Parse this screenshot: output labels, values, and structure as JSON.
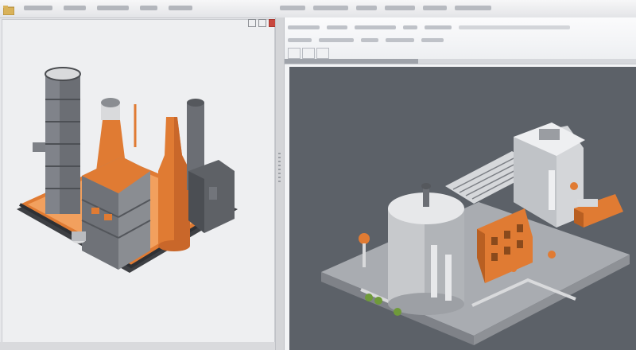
{
  "window": {
    "system_icon": "folder-icon",
    "controls": [
      "minimize-icon",
      "maximize-icon",
      "close-icon"
    ],
    "close_color": "#c8473e"
  },
  "colors": {
    "accent_orange": "#e07b33",
    "left_pane_bg": "#eeeff1",
    "viewport_bg": "#5c6168",
    "model_gray": "#8a8d92"
  },
  "left_pane": {
    "content": "isometric-factory-illustration"
  },
  "right_pane": {
    "viewport_content": "isometric-industrial-plant-model",
    "loading_progress": 0.38
  }
}
